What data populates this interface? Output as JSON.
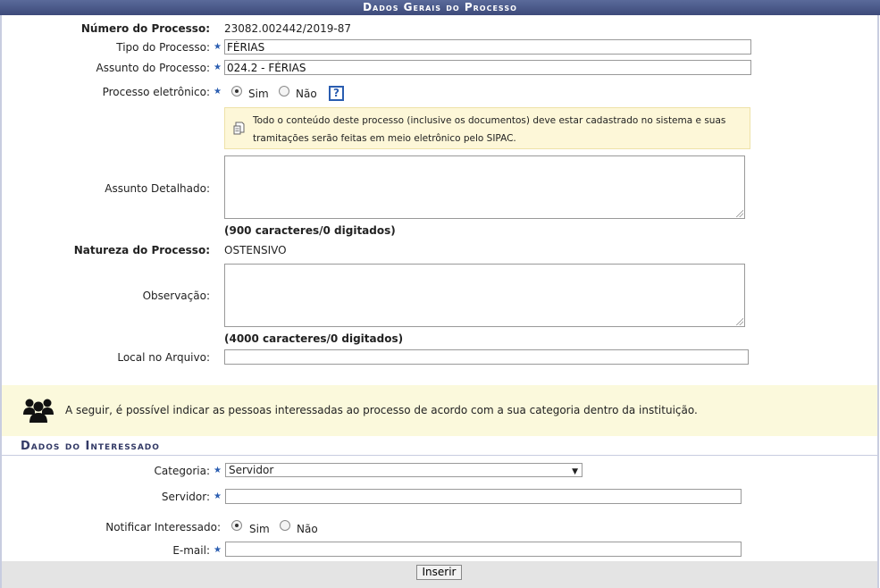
{
  "header": {
    "title": "Dados Gerais do Processo"
  },
  "form": {
    "numero": {
      "label": "Número do Processo:",
      "value": "23082.002442/2019-87"
    },
    "tipo": {
      "label": "Tipo do Processo:",
      "value": "FÉRIAS"
    },
    "assunto": {
      "label": "Assunto do Processo:",
      "value": "024.2 - FÉRIAS"
    },
    "eletronico": {
      "label": "Processo eletrônico:",
      "opt_yes": "Sim",
      "opt_no": "Não",
      "selected": "Sim",
      "help": "?"
    },
    "note": "Todo o conteúdo deste processo (inclusive os documentos) deve estar cadastrado no sistema e suas tramitações serão feitas em meio eletrônico pelo SIPAC.",
    "assunto_detalhado": {
      "label": "Assunto Detalhado:",
      "counter": "(900 caracteres/0 digitados)",
      "value": ""
    },
    "natureza": {
      "label": "Natureza do Processo:",
      "value": "OSTENSIVO"
    },
    "observacao": {
      "label": "Observação:",
      "counter": "(4000 caracteres/0 digitados)",
      "value": ""
    },
    "local": {
      "label": "Local no Arquivo:",
      "value": ""
    }
  },
  "info": {
    "text": "A seguir, é possível indicar as pessoas interessadas ao processo de acordo com a sua categoria dentro da instituição."
  },
  "interessado": {
    "title": "Dados do Interessado",
    "categoria": {
      "label": "Categoria:",
      "value": "Servidor"
    },
    "servidor": {
      "label": "Servidor:",
      "value": ""
    },
    "notificar": {
      "label": "Notificar Interessado:",
      "opt_yes": "Sim",
      "opt_no": "Não",
      "selected": "Sim"
    },
    "email": {
      "label": "E-mail:",
      "value": ""
    }
  },
  "actions": {
    "insert": "Inserir"
  },
  "icons": {
    "required": "star-icon",
    "note": "document-icon",
    "people": "group-icon"
  },
  "colors": {
    "header": "#3d4a7a",
    "required": "#2a5db0",
    "note_bg": "#fdf7d8"
  }
}
